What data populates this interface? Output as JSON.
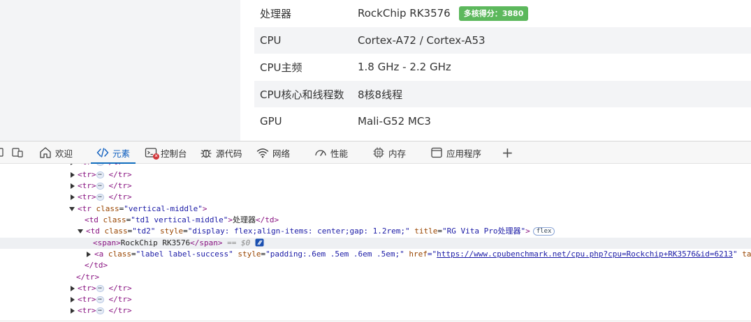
{
  "spec_table": {
    "rows": [
      {
        "label": "处理器",
        "value": "RockChip RK3576",
        "badge": "多核得分：3880"
      },
      {
        "label": "CPU",
        "value": "Cortex-A72 / Cortex-A53"
      },
      {
        "label": "CPU主频",
        "value": "1.8 GHz - 2.2 GHz"
      },
      {
        "label": "CPU核心和线程数",
        "value": "8核8线程"
      },
      {
        "label": "GPU",
        "value": "Mali-G52 MC3"
      }
    ],
    "badge_color": "#5cb85c"
  },
  "devtools": {
    "tabs": [
      {
        "label": "欢迎",
        "icon": "home-icon"
      },
      {
        "label": "元素",
        "icon": "code-icon",
        "active": true
      },
      {
        "label": "控制台",
        "icon": "console-icon"
      },
      {
        "label": "源代码",
        "icon": "bug-icon"
      },
      {
        "label": "网络",
        "icon": "wifi-icon"
      },
      {
        "label": "性能",
        "icon": "performance-icon"
      },
      {
        "label": "内存",
        "icon": "chip-icon"
      },
      {
        "label": "应用程序",
        "icon": "window-icon"
      }
    ],
    "add_tab": "+",
    "accent": "#0f6cbd"
  },
  "dom": {
    "tr_open": "<tr>",
    "tr_close": "</tr>",
    "ellipsis": "⋯",
    "tr_vm": {
      "open": "<tr",
      "attr": "class",
      "val": "\"vertical-middle\"",
      "close": ">"
    },
    "td1": {
      "open": "<td",
      "attr": "class",
      "val": "\"td1 vertical-middle\"",
      "close": ">",
      "text": "处理器",
      "end": "</td>"
    },
    "td2": {
      "open": "<td",
      "attr1": "class",
      "val1": "\"td2\"",
      "attr2": "style",
      "val2": "\"display: flex;align-items: center;gap: 1.2rem;\"",
      "attr3": "title",
      "val3": "\"RG Vita Pro处理器\"",
      "close": ">",
      "badge": "flex"
    },
    "span": {
      "open": "<span>",
      "text": "RockChip RK3576",
      "close": "</span>",
      "marker": "== $0"
    },
    "a": {
      "open": "<a",
      "attr1": "class",
      "val1": "\"label label-success\"",
      "attr2": "style",
      "val2": "\"padding:.6em .5em .6em .5em;\"",
      "attr3": "href",
      "eq": "=\"",
      "url": "https://www.cpubenchmark.net/cpu.php?cpu=Rockchip+RK3576&id=6213",
      "quote": "\"",
      "attr4": "tar"
    },
    "td_close": "</td>",
    "tr_close_line": "</tr>"
  }
}
